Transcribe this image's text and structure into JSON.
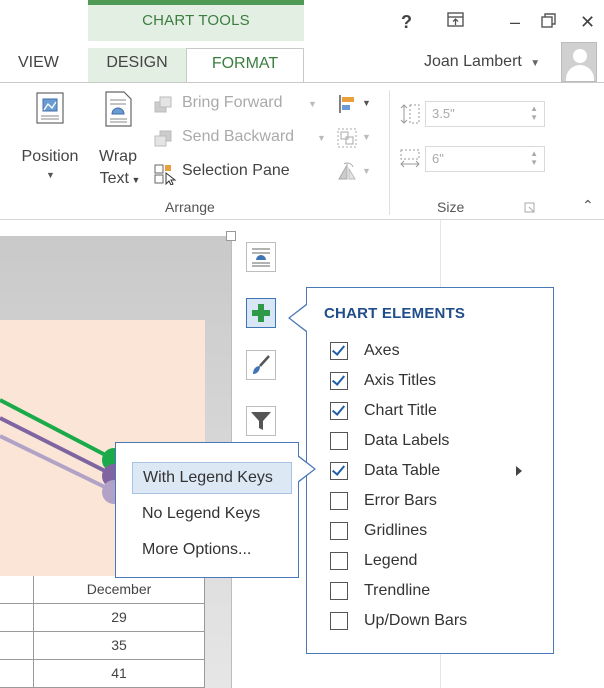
{
  "ribbon": {
    "context_title": "CHART TOOLS",
    "tabs": [
      {
        "label": "VIEW"
      },
      {
        "label": "DESIGN"
      },
      {
        "label": "FORMAT"
      }
    ],
    "window_controls": {
      "help": "?",
      "restore_ribbon": "⬒",
      "minimize": "–",
      "maximize": "🗗",
      "close": "✕"
    },
    "user_name": "Joan Lambert",
    "arrange": {
      "position_label": "Position",
      "wrap_text_label_1": "Wrap",
      "wrap_text_label_2": "Text",
      "bring_forward": "Bring Forward",
      "send_backward": "Send Backward",
      "selection_pane": "Selection Pane",
      "group_label": "Arrange"
    },
    "size": {
      "height_value": "3.5\"",
      "width_value": "6\"",
      "group_label": "Size"
    }
  },
  "data_table": {
    "header": "December",
    "values": [
      "29",
      "35",
      "41"
    ]
  },
  "chart_elements": {
    "title": "CHART ELEMENTS",
    "items": [
      {
        "label": "Axes",
        "checked": true
      },
      {
        "label": "Axis Titles",
        "checked": true
      },
      {
        "label": "Chart Title",
        "checked": true
      },
      {
        "label": "Data Labels",
        "checked": false
      },
      {
        "label": "Data Table",
        "checked": true,
        "has_submenu": true
      },
      {
        "label": "Error Bars",
        "checked": false
      },
      {
        "label": "Gridlines",
        "checked": false
      },
      {
        "label": "Legend",
        "checked": false
      },
      {
        "label": "Trendline",
        "checked": false
      },
      {
        "label": "Up/Down Bars",
        "checked": false
      }
    ]
  },
  "data_table_submenu": {
    "items": [
      {
        "label": "With Legend Keys",
        "highlighted": true
      },
      {
        "label": "No Legend Keys"
      },
      {
        "label": "More Options..."
      }
    ]
  },
  "colors": {
    "accent_green": "#4f9a55",
    "accent_blue": "#1f4e8a",
    "series_green": "#1aaa4a",
    "series_purple": "#8064a2",
    "series_lavender": "#b3a2c7"
  }
}
